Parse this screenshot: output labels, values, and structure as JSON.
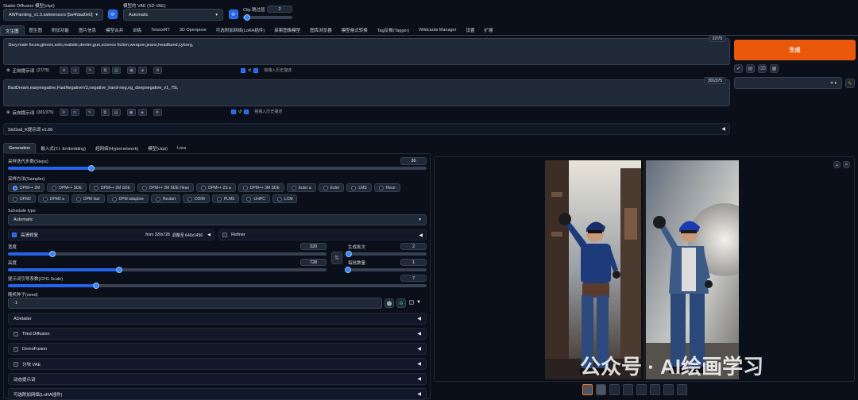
{
  "top": {
    "checkpoint_label": "Stable Diffusion 模型(ckpt)",
    "checkpoint_value": "AWPainting_v1.3.safetensors [5a4fdad0e0]",
    "vae_label": "模型的 VAE (SD VAE)",
    "vae_value": "Automatic",
    "clip_label": "Clip 跳过层",
    "clip_value": "2",
    "clip_fraction": 0.08
  },
  "main_tabs": [
    "文生图",
    "图生图",
    "附加功能",
    "图片信息",
    "模型合并",
    "训练",
    "TensorRT",
    "3D Openpose",
    "可选附加网络(LoRA插件)",
    "探索图像模型",
    "图库浏览器",
    "模型格式转换",
    "Tag反推(Tagger)",
    "Wildcards Manager",
    "设置",
    "扩展"
  ],
  "main_tab_selected": 0,
  "prompt": {
    "text": "1boy,male focus,gloves,solo,realistic,denim,gun,science fiction,weapon,jeans,headband,cyborg,",
    "counter": "27/75",
    "toolbar_label": "正向提示词",
    "toolbar_count": "(27/75)",
    "drop_label": "拖拽入历史描述"
  },
  "neg_prompt": {
    "text": "BadDream,easynegative,FastNegativeV2,negative_hand-neg,ng_deepnegative_v1_75t,",
    "counter": "301/375",
    "toolbar_label": "反向提示词",
    "toolbar_count": "(301/375)",
    "drop_label": "拖拽入历史描述"
  },
  "generate_label": "生成",
  "style_tools": [
    "↙",
    "🗑",
    "📋",
    "🗑"
  ],
  "sixgod_label": "SixGod_K提示词 v1.66",
  "sub_tabs": [
    "Generation",
    "嵌入式(T.I. Embedding)",
    "超网络(Hypernetwork)",
    "模型(ckpt)",
    "Lora"
  ],
  "sub_tab_selected": 0,
  "steps": {
    "label": "采样迭代步数(Steps)",
    "value": "30",
    "fraction": 0.2
  },
  "sampler": {
    "label": "采样方法(Sampler)",
    "options": [
      "DPM++ 2M",
      "DPM++ SDE",
      "DPM++ 2M SDE",
      "DPM++ 2M SDE Heun",
      "DPM++ 2S a",
      "DPM++ 3M SDE",
      "Euler a",
      "Euler",
      "LMS",
      "Heun",
      "DPM2",
      "DPM2 a",
      "DPM fast",
      "DPM adaptive",
      "Restart",
      "DDIM",
      "PLMS",
      "UniPC",
      "LCM"
    ],
    "selected": "DPM++ 2M"
  },
  "schedule": {
    "label": "Schedule type",
    "value": "Automatic"
  },
  "hires": {
    "label": "高清修复",
    "info_prefix": "from 320x728",
    "info_target": "调整至 640x1456",
    "refiner_label": "Refiner"
  },
  "width": {
    "label": "宽度",
    "value": "320",
    "fraction": 0.14
  },
  "height": {
    "label": "高度",
    "value": "728",
    "fraction": 0.35
  },
  "swap_icon": "⇅",
  "batch_count": {
    "label": "生成批次",
    "value": "2",
    "fraction": 0.01
  },
  "batch_size": {
    "label": "每批数量",
    "value": "1",
    "fraction": 0.0
  },
  "cfg": {
    "label": "提示词引导系数(CFG Scale)",
    "value": "7",
    "fraction": 0.21
  },
  "seed": {
    "label": "随机种子(seed)",
    "value": "-1"
  },
  "accordions": [
    {
      "label": "ADetailer",
      "check": false
    },
    {
      "label": "Tiled Diffusion",
      "check": true
    },
    {
      "label": "DemoFusion",
      "check": true
    },
    {
      "label": "分块 VAE",
      "check": true
    },
    {
      "label": "动态提示词",
      "check": false
    },
    {
      "label": "可选附加网络(LoRA插件)",
      "check": false
    }
  ],
  "watermark": "公众号 · AI绘画学习",
  "thumbnail_count": 8,
  "colors": {
    "accent": "#ea580c",
    "bg": "#0b0f19",
    "primary": "#2563eb"
  }
}
